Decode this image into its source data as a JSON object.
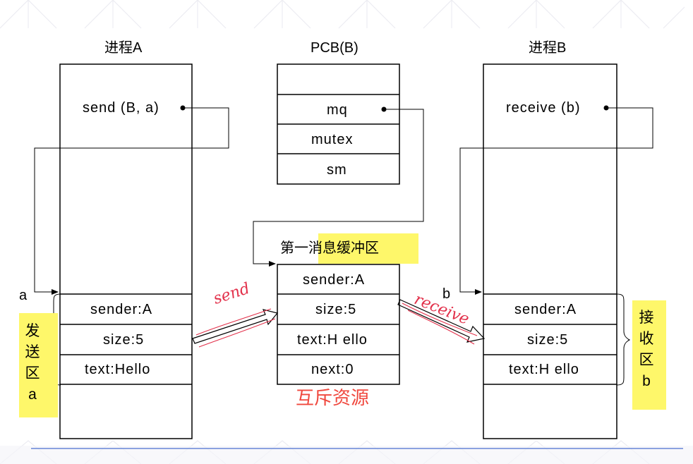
{
  "process_a": {
    "title": "进程A",
    "call": "send (B, a)",
    "pointer_label": "a",
    "message": [
      "sender:A",
      "size:5",
      "text:Hello"
    ],
    "region_label": [
      "发",
      "送",
      "区",
      "a"
    ]
  },
  "pcb": {
    "title": "PCB(B)",
    "fields": [
      "mq",
      "mutex",
      "sm"
    ]
  },
  "buffer": {
    "title": "第一消息缓冲区",
    "fields": [
      "sender:A",
      "size:5",
      "text:H ello",
      "next:0"
    ],
    "note": "互斥资源"
  },
  "process_b": {
    "title": "进程B",
    "call": "receive (b)",
    "pointer_label": "b",
    "message": [
      "sender:A",
      "size:5",
      "text:H ello"
    ],
    "region_label": [
      "接",
      "收",
      "区",
      "b"
    ]
  },
  "annotations": {
    "send": "send",
    "receive": "receive"
  },
  "colors": {
    "highlight": "#fef76a",
    "note_red": "#f0483e",
    "handwriting": "#e2304a",
    "bottom_rule": "#4a6fd0"
  }
}
